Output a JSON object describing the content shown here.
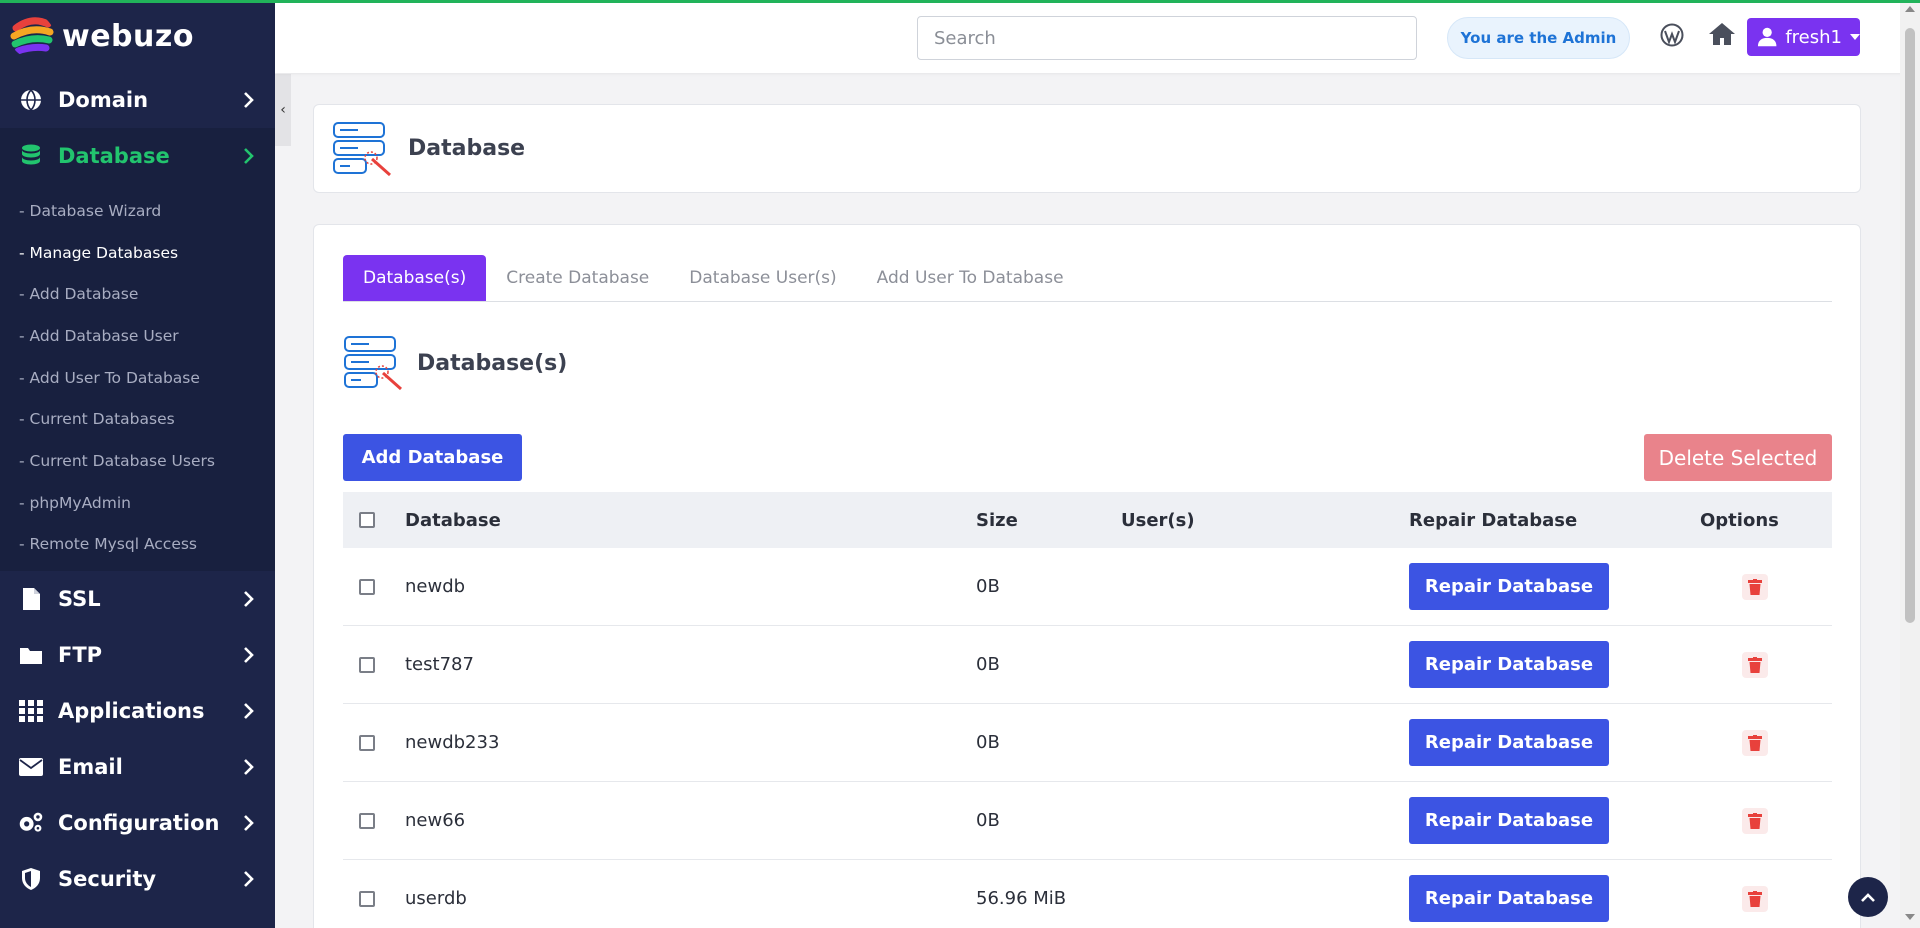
{
  "brand": {
    "name": "webuzo",
    "colors": [
      "#e8413c",
      "#f6a623",
      "#22c46e",
      "#7a33f0"
    ]
  },
  "sidebar": {
    "items": [
      {
        "label": "Domain",
        "icon": "globe-icon"
      },
      {
        "label": "Database",
        "icon": "database-icon",
        "active": true,
        "submenu": [
          "- Database Wizard",
          "- Manage Databases",
          "- Add Database",
          "- Add Database User",
          "- Add User To Database",
          "- Current Databases",
          "- Current Database Users",
          "- phpMyAdmin",
          "- Remote Mysql Access"
        ],
        "current_sub": "- Manage Databases"
      },
      {
        "label": "SSL",
        "icon": "file-icon"
      },
      {
        "label": "FTP",
        "icon": "folder-icon"
      },
      {
        "label": "Applications",
        "icon": "grid-icon"
      },
      {
        "label": "Email",
        "icon": "envelope-icon"
      },
      {
        "label": "Configuration",
        "icon": "gears-icon"
      },
      {
        "label": "Security",
        "icon": "shield-icon"
      }
    ]
  },
  "header": {
    "search_placeholder": "Search",
    "admin_badge": "You are the Admin",
    "user": "fresh1"
  },
  "page": {
    "title": "Database",
    "tabs": [
      "Database(s)",
      "Create Database",
      "Database User(s)",
      "Add User To Database"
    ],
    "active_tab": "Database(s)",
    "section_title": "Database(s)",
    "add_button": "Add Database",
    "delete_button": "Delete Selected",
    "table": {
      "columns": [
        "Database",
        "Size",
        "User(s)",
        "Repair Database",
        "Options"
      ],
      "rows": [
        {
          "name": "newdb",
          "size": "0B",
          "users": "",
          "repair": "Repair Database"
        },
        {
          "name": "test787",
          "size": "0B",
          "users": "",
          "repair": "Repair Database"
        },
        {
          "name": "newdb233",
          "size": "0B",
          "users": "",
          "repair": "Repair Database"
        },
        {
          "name": "new66",
          "size": "0B",
          "users": "",
          "repair": "Repair Database"
        },
        {
          "name": "userdb",
          "size": "56.96 MiB",
          "users": "",
          "repair": "Repair Database"
        }
      ]
    }
  },
  "colors": {
    "sidebar_bg": "#1d2549",
    "accent_purple": "#7a33f0",
    "primary_blue": "#3c54e3",
    "danger_light": "#e9838b",
    "active_green": "#22c46e"
  }
}
